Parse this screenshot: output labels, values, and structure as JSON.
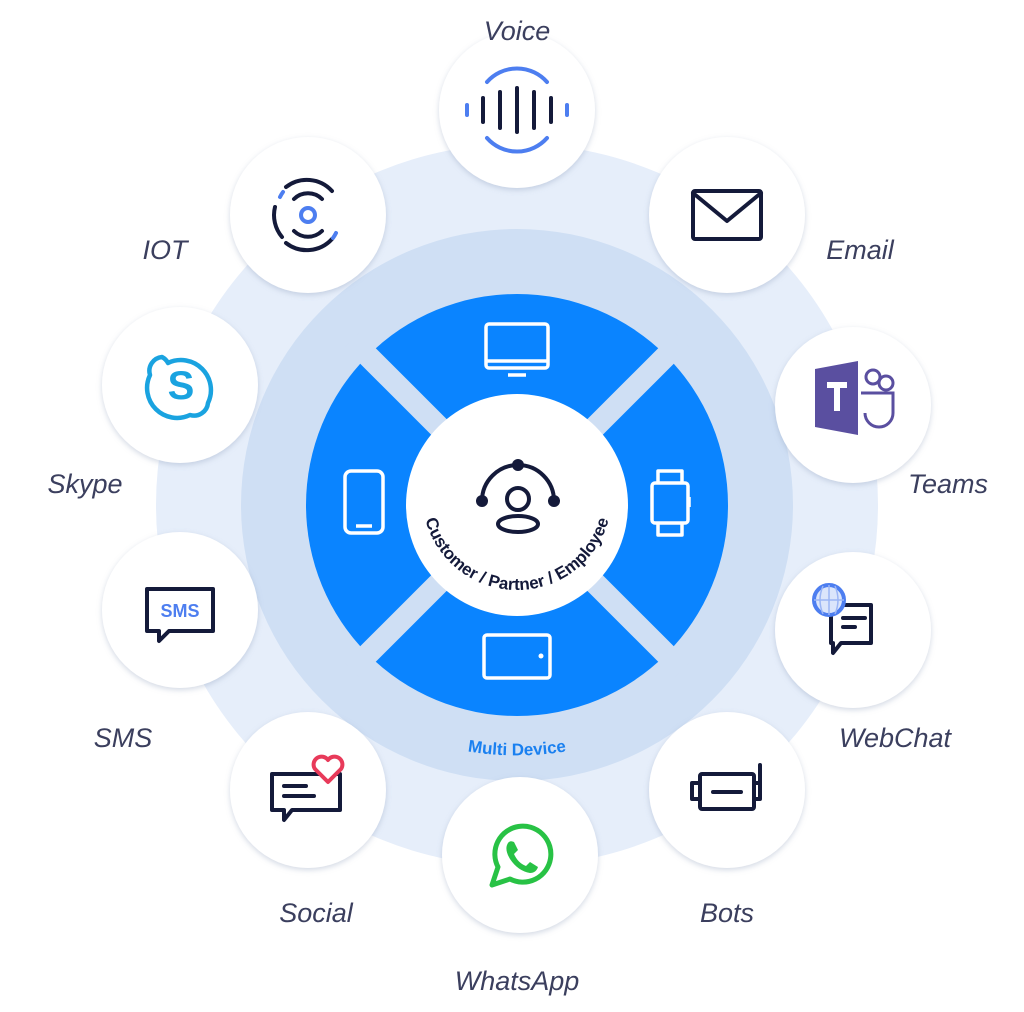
{
  "center": {
    "label": "Customer / Partner / Employee",
    "icon": "person-network-icon"
  },
  "ring": {
    "label": "Multi Device",
    "devices": [
      "desktop-monitor",
      "smartwatch",
      "tablet",
      "smartphone"
    ]
  },
  "colors": {
    "device_ring": "#0a84ff",
    "outer_ring": "#e6eefa",
    "middle_ring": "#cfdff4",
    "label_text": "#3b3f5e",
    "teams_purple": "#5a4fa0",
    "skype_blue": "#1aa3e0",
    "whatsapp_green": "#28c245",
    "social_heart": "#e83a5a"
  },
  "channels": [
    {
      "label": "Voice",
      "icon": "voice-waveform-icon"
    },
    {
      "label": "Email",
      "icon": "envelope-icon"
    },
    {
      "label": "Teams",
      "icon": "microsoft-teams-icon"
    },
    {
      "label": "WebChat",
      "icon": "webchat-globe-icon"
    },
    {
      "label": "Bots",
      "icon": "bot-icon"
    },
    {
      "label": "WhatsApp",
      "icon": "whatsapp-icon"
    },
    {
      "label": "Social",
      "icon": "social-chat-heart-icon"
    },
    {
      "label": "SMS",
      "icon": "sms-bubble-icon",
      "icon_text": "SMS"
    },
    {
      "label": "Skype",
      "icon": "skype-icon"
    },
    {
      "label": "IOT",
      "icon": "iot-signal-icon"
    }
  ]
}
